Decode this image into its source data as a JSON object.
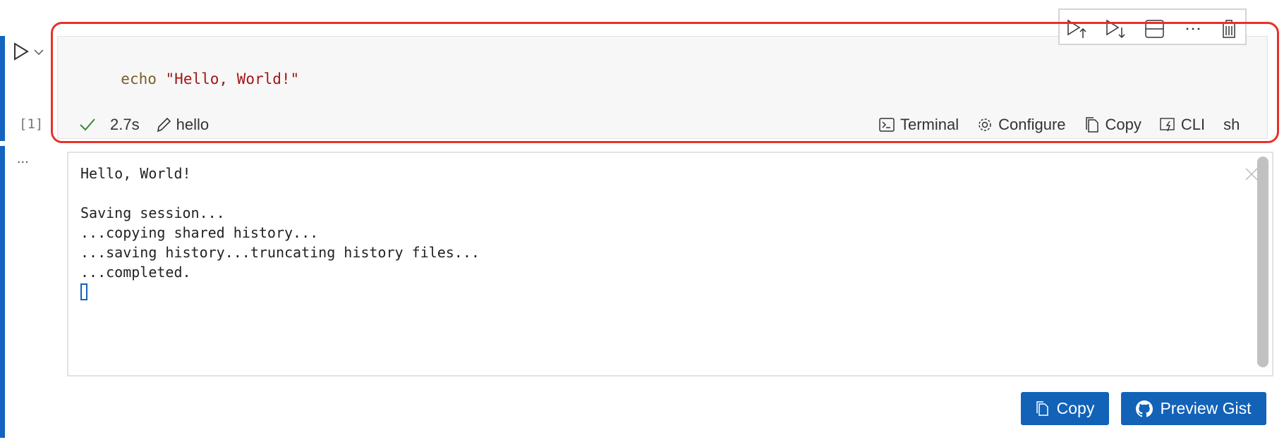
{
  "cell": {
    "execution_count": "[1]",
    "code": {
      "keyword": "echo",
      "string": "\"Hello, World!\""
    },
    "status": {
      "duration": "2.7s",
      "name": "hello"
    },
    "actions": [
      {
        "label": "Terminal",
        "icon": "terminal-icon"
      },
      {
        "label": "Configure",
        "icon": "gear-icon"
      },
      {
        "label": "Copy",
        "icon": "copy-icon"
      },
      {
        "label": "CLI",
        "icon": "cli-icon"
      },
      {
        "label": "sh"
      }
    ],
    "toolbar": [
      "run-above-icon",
      "run-below-icon",
      "split-cell-icon",
      "more-icon",
      "trash-icon"
    ]
  },
  "output": {
    "more": "...",
    "lines": [
      "Hello, World!",
      "",
      "Saving session...",
      "...copying shared history...",
      "...saving history...truncating history files...",
      "...completed."
    ]
  },
  "buttons": {
    "copy": "Copy",
    "preview_gist": "Preview Gist"
  },
  "colors": {
    "accent": "#1262b8",
    "focus_border": "#e8302a",
    "keyword": "#795e26",
    "string": "#a31515",
    "success": "#388a34"
  }
}
